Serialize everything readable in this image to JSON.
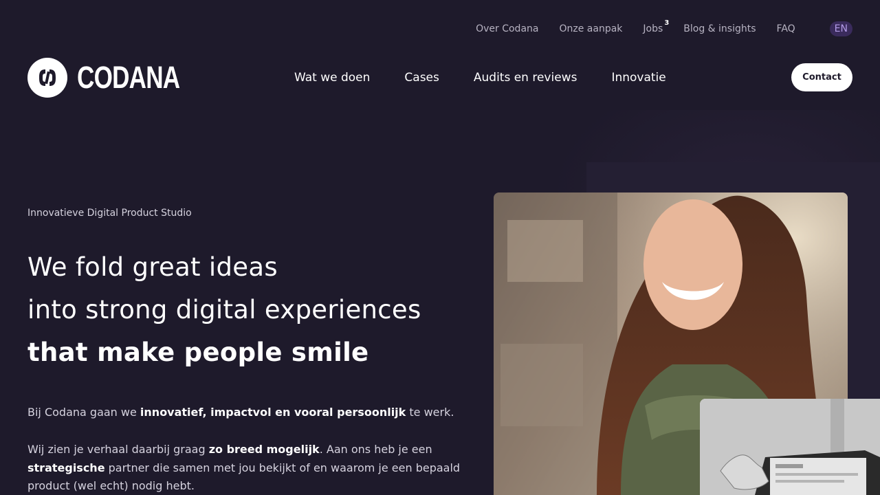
{
  "topbar": {
    "links": [
      "Over Codana",
      "Onze aanpak",
      "Jobs",
      "Blog & insights",
      "FAQ"
    ],
    "jobs_count": "3",
    "language": "EN"
  },
  "brand": {
    "name": "CODANA"
  },
  "mainnav": {
    "items": [
      "Wat we doen",
      "Cases",
      "Audits en reviews",
      "Innovatie"
    ],
    "contact_label": "Contact"
  },
  "hero": {
    "eyebrow": "Innovatieve Digital Product Studio",
    "headline_line1": "We fold great ideas",
    "headline_line2": "into strong digital experiences",
    "headline_line3": "that make people smile",
    "para1": {
      "pre": "Bij Codana gaan we ",
      "bold": "innovatief, impactvol en vooral persoonlijk",
      "post": " te werk."
    },
    "para2": {
      "pre": "Wij zien je verhaal daarbij graag ",
      "bold1": "zo breed mogelijk",
      "mid": ". Aan ons heb je een ",
      "bold2": "strategische",
      "post": " partner die samen met jou bekijkt of en waarom je een bepaald product (wel echt) nodig hebt."
    }
  },
  "images": {
    "main": "photo-smiling-woman",
    "secondary": "photo-hand-holding-laptop"
  },
  "colors": {
    "background": "#1e1a2b",
    "accent_badge": "#3a2b5c",
    "accent_badge_text": "#b49ce8",
    "text_muted": "#b7b3c2"
  }
}
